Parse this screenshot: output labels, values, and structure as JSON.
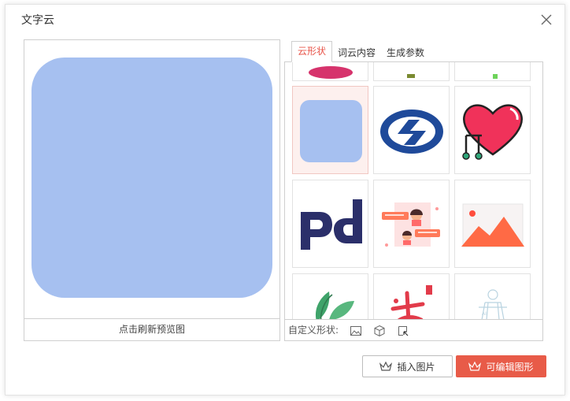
{
  "dialog": {
    "title": "文字云",
    "close_icon": "close-icon"
  },
  "preview": {
    "shape_color": "#a6c0f0",
    "refresh_label": "点击刷新预览图"
  },
  "tabs": [
    {
      "label": "云形状",
      "active": true
    },
    {
      "label": "词云内容",
      "active": false
    },
    {
      "label": "生成参数",
      "active": false
    }
  ],
  "shapes": {
    "selected_index": 0,
    "items": [
      {
        "name": "rounded-square-shape"
      },
      {
        "name": "metro-logo-shape"
      },
      {
        "name": "music-heart-shape"
      },
      {
        "name": "psd-letters-shape"
      },
      {
        "name": "chat-people-shape"
      },
      {
        "name": "landscape-image-shape"
      },
      {
        "name": "leaves-shape"
      },
      {
        "name": "calligraphy-shape"
      },
      {
        "name": "figure-outline-shape"
      }
    ],
    "custom_label": "自定义形状:",
    "custom_icons": [
      "image-icon",
      "cube-icon",
      "crop-icon"
    ]
  },
  "buttons": {
    "insert_label": "插入图片",
    "editable_label": "可编辑图形"
  },
  "colors": {
    "accent": "#e85b48",
    "tab_active": "#e8554a"
  }
}
